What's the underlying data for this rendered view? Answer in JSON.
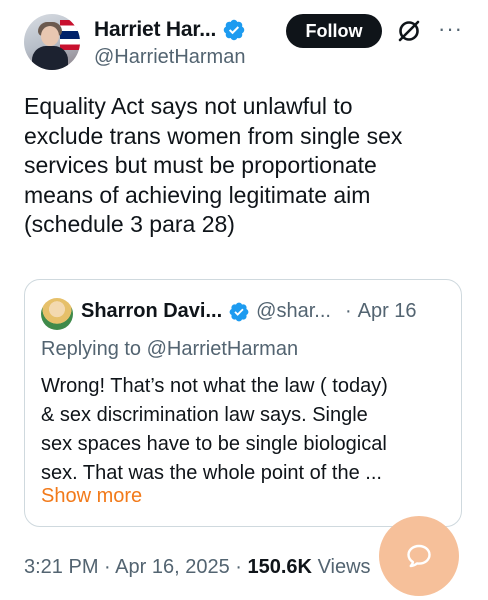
{
  "author": {
    "display_name": "Harriet Har...",
    "handle": "@HarrietHarman",
    "avatar_icon": "profile-photo",
    "verified_icon": "verified-badge-icon"
  },
  "actions": {
    "follow_label": "Follow",
    "grok_icon": "grok-icon",
    "more_icon": "more-icon",
    "more_glyph": "···"
  },
  "tweet": {
    "text": "Equality Act says not unlawful to\nexclude trans women from single sex\nservices but must be proportionate\nmeans of achieving legitimate aim\n(schedule 3 para 28)"
  },
  "quoted_tweet": {
    "display_name": "Sharron Davi...",
    "handle": "@shar...",
    "separator": "·",
    "date": "Apr 16",
    "replying_to": "Replying to @HarrietHarman",
    "text": "Wrong! That’s not what the law ( today)\n& sex discrimination law says. Single\nsex spaces have to be single biological\nsex. That was the whole point of the ...",
    "show_more": "Show more"
  },
  "meta": {
    "time": "3:21 PM",
    "sep1": "·",
    "date": "Apr 16, 2025",
    "sep2": "·",
    "views_count": "150.6K",
    "views_label": "Views"
  },
  "colors": {
    "text": "#0f1419",
    "secondary": "#536471",
    "verified": "#1d9bf0",
    "show_more": "#f27a1a",
    "fab": "#f6c09a"
  }
}
